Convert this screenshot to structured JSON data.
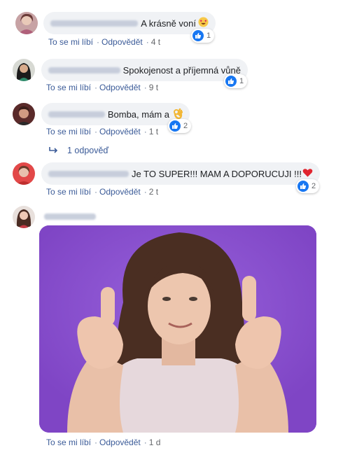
{
  "actions": {
    "like": "To se mi líbí",
    "reply": "Odpovědět"
  },
  "comments": [
    {
      "text": "A krásně voní",
      "time": "4 t",
      "reactions": "1"
    },
    {
      "text": "Spokojenost a příjemná vůně",
      "time": "9 t",
      "reactions": "1"
    },
    {
      "text": "Bomba, mám a",
      "time": "1 t",
      "reactions": "2",
      "replies": "1 odpověď"
    },
    {
      "text": "Je TO SUPER!!! MAM A DOPORUCUJI !!!",
      "time": "2 t",
      "reactions": "2"
    },
    {
      "text": "",
      "time": "1 d"
    }
  ],
  "colors": {
    "link": "#3b5b98",
    "like_blue": "#1877f2",
    "bubble": "#f0f2f5",
    "gif_bg": "#8a4fd0"
  },
  "icons": [
    "heart-eyes-emoji-icon",
    "ok-hand-emoji-icon",
    "red-heart-emoji-icon",
    "like-reaction-icon",
    "reply-arrow-icon"
  ]
}
